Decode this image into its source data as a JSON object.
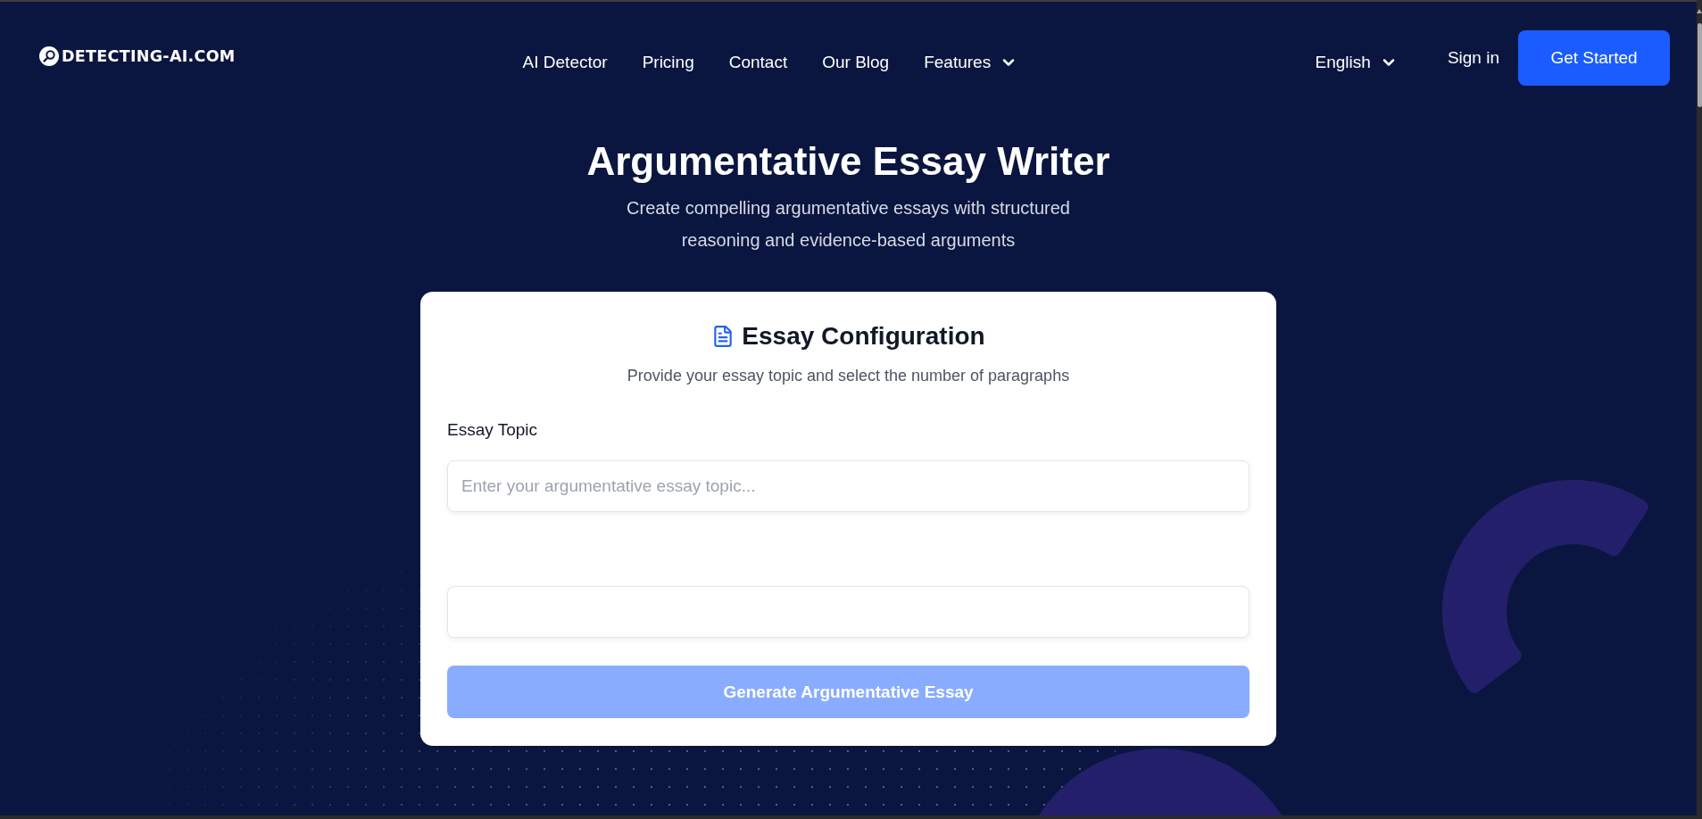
{
  "header": {
    "logo": "DETECTING-AI.COM",
    "nav": [
      {
        "label": "AI Detector",
        "kind": "link"
      },
      {
        "label": "Pricing",
        "kind": "link"
      },
      {
        "label": "Contact",
        "kind": "link"
      },
      {
        "label": "Our Blog",
        "kind": "link"
      },
      {
        "label": "Features",
        "kind": "dropdown"
      }
    ],
    "language": "English",
    "sign_in": "Sign in",
    "cta": "Get Started"
  },
  "hero": {
    "title": "Argumentative Essay Writer",
    "subtitle": "Create compelling argumentative essays with structured reasoning and evidence-based arguments"
  },
  "card": {
    "title": "Essay Configuration",
    "subtitle": "Provide your essay topic and select the number of paragraphs",
    "fields": [
      {
        "kind": "text",
        "label": "Essay Topic",
        "placeholder": "Enter your argumentative essay topic..."
      },
      {
        "kind": "text"
      }
    ],
    "submit": {
      "label": "Generate Argumentative Essay",
      "disabled": true
    }
  }
}
